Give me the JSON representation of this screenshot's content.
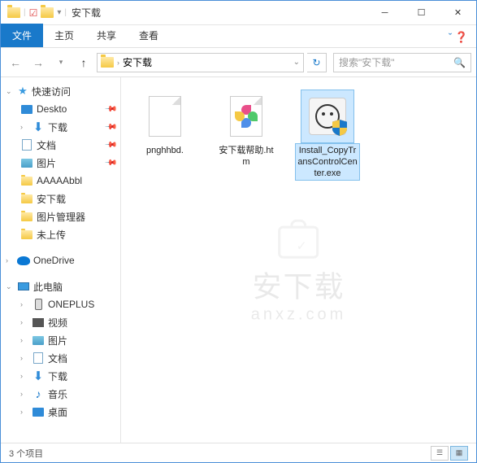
{
  "title": "安下载",
  "ribbon": {
    "file": "文件",
    "home": "主页",
    "share": "共享",
    "view": "查看"
  },
  "breadcrumb": {
    "current": "安下载"
  },
  "search": {
    "placeholder": "搜索\"安下载\""
  },
  "sidebar": {
    "quick_access": "快速访问",
    "items": [
      {
        "label": "Deskto",
        "type": "desktop",
        "pinned": true
      },
      {
        "label": "下载",
        "type": "download",
        "pinned": true
      },
      {
        "label": "文档",
        "type": "doc",
        "pinned": true
      },
      {
        "label": "图片",
        "type": "pic",
        "pinned": true
      },
      {
        "label": "AAAAAbbl",
        "type": "folder"
      },
      {
        "label": "安下载",
        "type": "folder"
      },
      {
        "label": "图片管理器",
        "type": "folder"
      },
      {
        "label": "未上传",
        "type": "folder"
      }
    ],
    "onedrive": "OneDrive",
    "thispc": "此电脑",
    "pc_items": [
      {
        "label": "ONEPLUS",
        "type": "phone"
      },
      {
        "label": "视频",
        "type": "video"
      },
      {
        "label": "图片",
        "type": "pic"
      },
      {
        "label": "文档",
        "type": "doc"
      },
      {
        "label": "下载",
        "type": "download"
      },
      {
        "label": "音乐",
        "type": "music"
      },
      {
        "label": "桌面",
        "type": "desktop"
      }
    ]
  },
  "files": [
    {
      "name": "pnghhbd.",
      "type": "blank"
    },
    {
      "name": "安下载帮助.htm",
      "type": "htm"
    },
    {
      "name": "Install_CopyTransControlCenter.exe",
      "type": "exe",
      "selected": true
    }
  ],
  "status": {
    "count": "3 个项目"
  },
  "watermark": {
    "main": "安下载",
    "sub": "anxz.com"
  }
}
